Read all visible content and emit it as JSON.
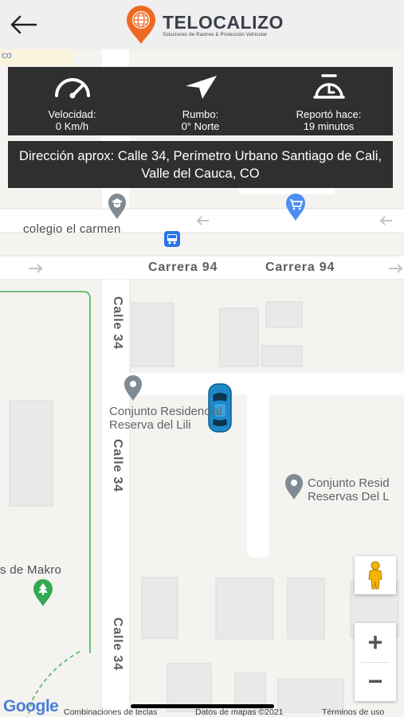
{
  "header": {
    "brand": "TELOCALIZO",
    "tagline": "Soluciones de Rastreo & Protección Vehicular"
  },
  "info": {
    "speed_label": "Velocidad:",
    "speed_value": "0 Km/h",
    "heading_label": "Rumbo:",
    "heading_value": "0° Norte",
    "reported_label": "Reportó hace:",
    "reported_value": "19 minutos"
  },
  "address": "Dirección aprox: Calle 34, Perímetro Urbano Santiago de Cali, Valle del Cauca, CO",
  "map": {
    "streets": {
      "carrera_left": "Carrera 94",
      "carrera_right": "Carrera 94",
      "calle_top": "Calle 34",
      "calle_mid": "Calle 34",
      "calle_bottom": "Calle 34"
    },
    "pois": {
      "school": "colegio el carmen",
      "conjunto1_line1": "Conjunto Residencial",
      "conjunto1_line2": "Reserva del Lili",
      "conjunto2_line1": "Conjunto Resid",
      "conjunto2_line2": "Reservas Del L",
      "makro": "s de Makro"
    }
  },
  "controls": {
    "zoom_in": "+",
    "zoom_out": "−"
  },
  "footer": {
    "google": "Google",
    "shortcuts": "Combinaciones de teclas",
    "map_data": "Datos de mapas ©2021",
    "terms": "Términos de uso"
  },
  "colors": {
    "panel": "#2f2f2f",
    "logo_orange": "#ee6a24",
    "car_blue": "#1e88c9",
    "park_green": "#34a853"
  }
}
